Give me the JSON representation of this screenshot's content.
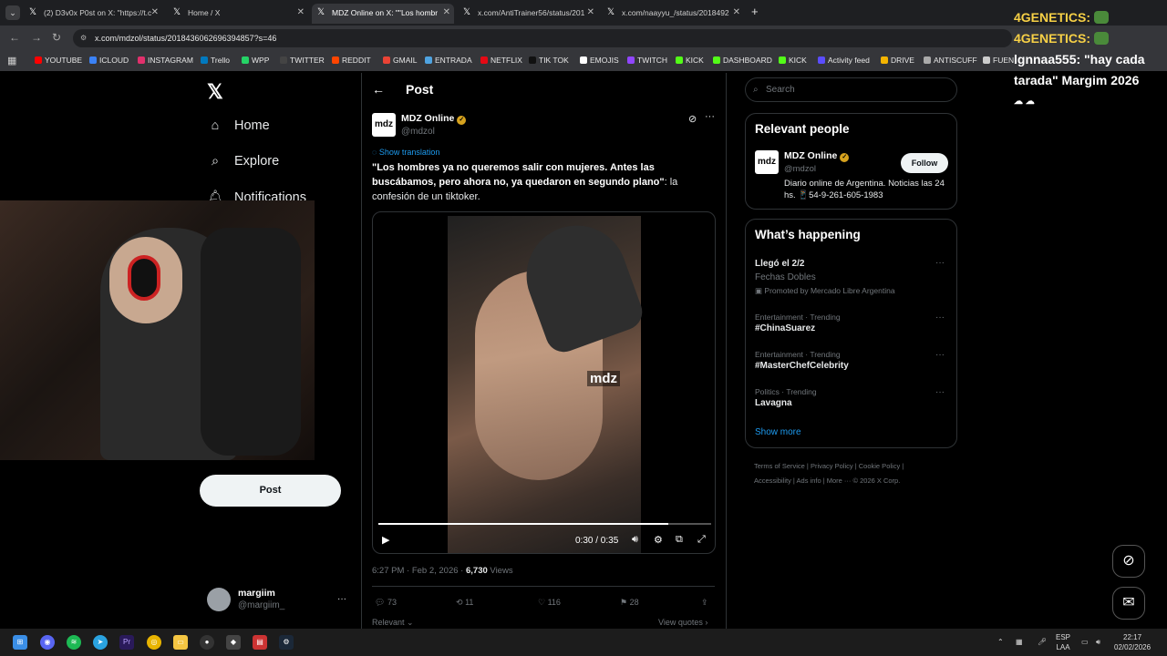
{
  "browser": {
    "tabs": [
      {
        "label": "(2) D3v0x P0st on X: \"https://t.c",
        "active": false
      },
      {
        "label": "Home / X",
        "active": false
      },
      {
        "label": "MDZ Online on X: \"\"Los hombr",
        "active": true
      },
      {
        "label": "x.com/AntiTrainer56/status/201",
        "active": false
      },
      {
        "label": "x.com/naayyu_/status/2018492",
        "active": false
      }
    ],
    "new_tab": "+",
    "url": "x.com/mdzol/status/2018436062696394857?s=46",
    "bookmarks": [
      {
        "label": "YOUTUBE",
        "color": "#ff0000"
      },
      {
        "label": "ICLOUD",
        "color": "#3b82f6"
      },
      {
        "label": "INSTAGRAM",
        "color": "#e1306c"
      },
      {
        "label": "Trello",
        "color": "#0079bf"
      },
      {
        "label": "WPP",
        "color": "#25d366"
      },
      {
        "label": "TWITTER",
        "color": "#444444"
      },
      {
        "label": "REDDIT",
        "color": "#ff4500"
      },
      {
        "label": "GMAIL",
        "color": "#ea4335"
      },
      {
        "label": "ENTRADA",
        "color": "#4fa3e0"
      },
      {
        "label": "NETFLIX",
        "color": "#e50914"
      },
      {
        "label": "TIK TOK",
        "color": "#111111"
      },
      {
        "label": "EMOJIS",
        "color": "#ffffff"
      },
      {
        "label": "TWITCH",
        "color": "#9146ff"
      },
      {
        "label": "KICK",
        "color": "#53fc18"
      },
      {
        "label": "DASHBOARD",
        "color": "#53fc18"
      },
      {
        "label": "KICK",
        "color": "#53fc18"
      },
      {
        "label": "Activity feed",
        "color": "#5b4dff"
      },
      {
        "label": "DRIVE",
        "color": "#f4b400"
      },
      {
        "label": "ANTISCUFF",
        "color": "#aaaaaa"
      },
      {
        "label": "FUEN",
        "color": "#cccccc"
      }
    ]
  },
  "overlay": {
    "lines": [
      {
        "user": "4GENETICS:",
        "text": ""
      },
      {
        "user": "4GENETICS:",
        "text": ""
      },
      {
        "user": "lgnnaa555:",
        "text": "\"hay cada"
      },
      {
        "user": "",
        "text": "tarada\" Margim 2026"
      }
    ]
  },
  "nav": {
    "home": "Home",
    "explore": "Explore",
    "notifications": "Notifications",
    "post_button": "Post",
    "account_name": "margiim",
    "account_handle": "@margiim_",
    "more": "···"
  },
  "post": {
    "header": "Post",
    "author_name": "MDZ Online",
    "author_handle": "@mdzol",
    "logo_text": "mdz",
    "show_translation": "Show translation",
    "text_bold": "\"Los hombres ya no queremos salir con mujeres. Antes las buscábamos, pero ahora no, ya quedaron en segundo plano\"",
    "text_rest": ": la confesión de un tiktoker.",
    "video": {
      "watermark": "mdz",
      "time": "0:30 / 0:35",
      "progress": 0.87
    },
    "timestamp": "6:27 PM · Feb 2, 2026 · ",
    "views_count": "6,730",
    "views_label": " Views",
    "replies": "73",
    "reposts": "11",
    "likes": "116",
    "bookmarks": "28",
    "sort": "Relevant",
    "view_quotes": "View quotes"
  },
  "sidebar": {
    "search_placeholder": "Search",
    "relevant_title": "Relevant people",
    "person_name": "MDZ Online",
    "person_handle": "@mdzol",
    "follow": "Follow",
    "person_bio": "Diario online de Argentina. Noticias las 24 hs. 📱54-9-261-605-1983",
    "happening_title": "What’s happening",
    "trends": [
      {
        "title": "Llegó el 2/2",
        "sub": "Fechas Dobles",
        "promo": "Promoted by Mercado Libre Argentina"
      },
      {
        "context": "Entertainment · Trending",
        "title": "#ChinaSuarez"
      },
      {
        "context": "Entertainment · Trending",
        "title": "#MasterChefCelebrity"
      },
      {
        "context": "Politics · Trending",
        "title": "Lavagna"
      }
    ],
    "show_more": "Show more",
    "footer_1": "Terms of Service  |  Privacy Policy  |  Cookie Policy  |",
    "footer_2": "Accessibility  |  Ads info  |  More ···  © 2026 X Corp."
  },
  "taskbar": {
    "lang_1": "ESP",
    "lang_2": "LAA",
    "time": "22:17",
    "date": "02/02/2026"
  }
}
